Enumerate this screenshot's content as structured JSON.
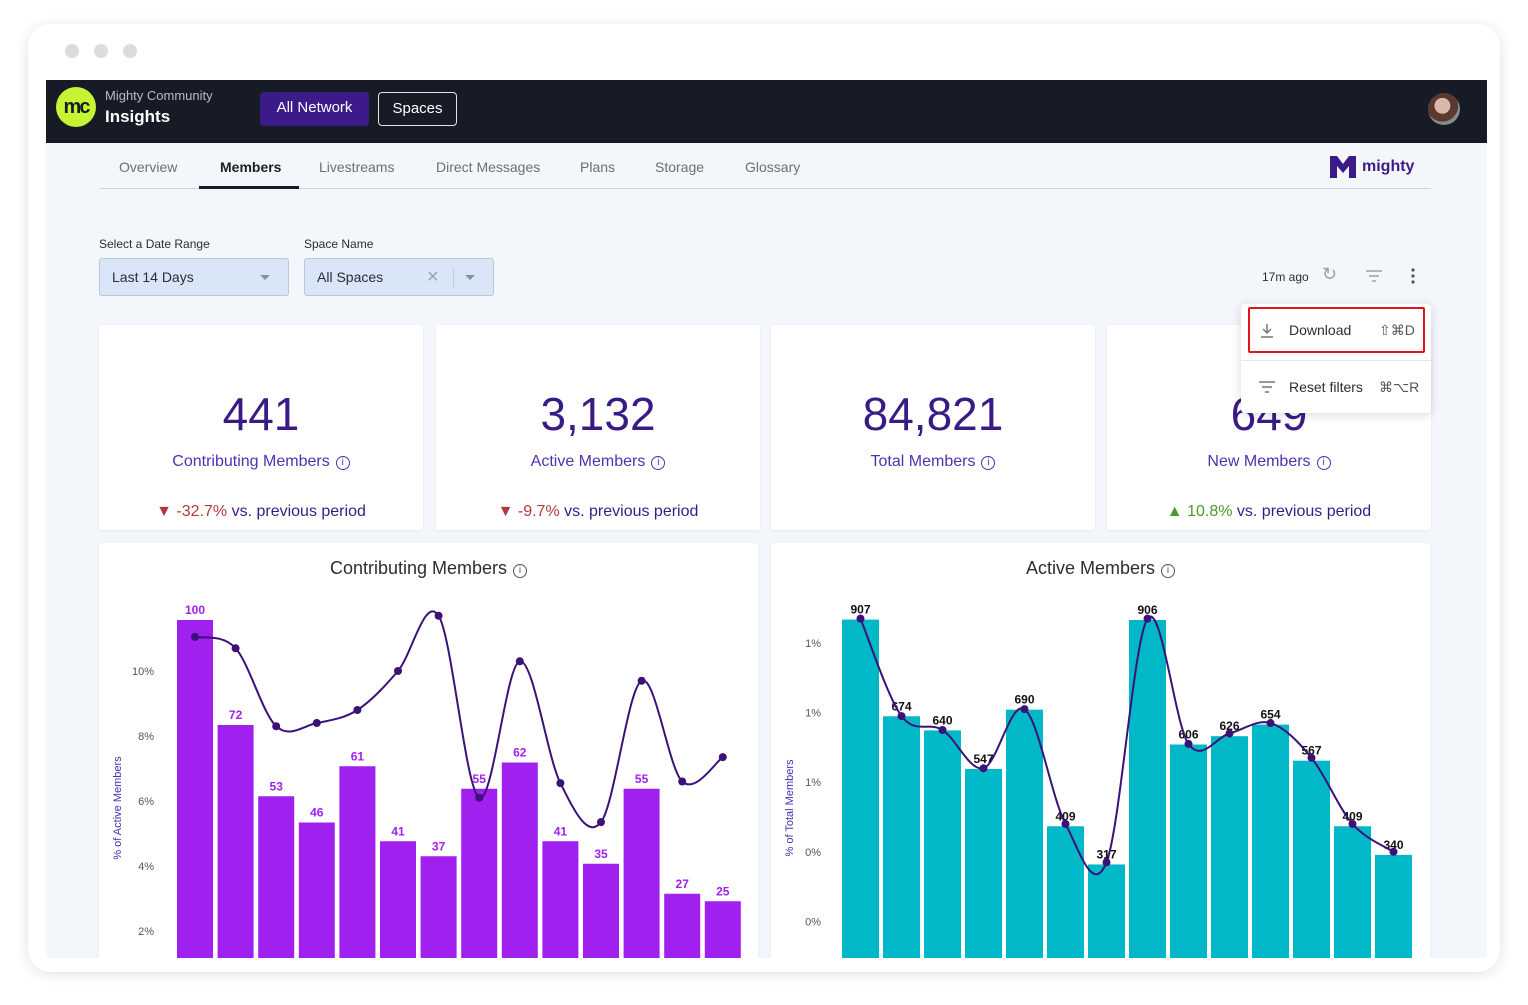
{
  "header": {
    "org": "Mighty Community",
    "title": "Insights",
    "logo_text": "mc",
    "buttons": [
      "All Network",
      "Spaces"
    ],
    "accent": "#3d1a8a"
  },
  "tabs": [
    "Overview",
    "Members",
    "Livestreams",
    "Direct Messages",
    "Plans",
    "Storage",
    "Glossary"
  ],
  "active_tab": "Members",
  "brand": "mighty",
  "filters": {
    "date_label": "Select a Date Range",
    "date_value": "Last 14 Days",
    "space_label": "Space Name",
    "space_value": "All Spaces"
  },
  "toolbar": {
    "updated": "17m ago"
  },
  "menu": {
    "items": [
      {
        "label": "Download",
        "shortcut": "⇧⌘D",
        "icon": "download-icon"
      },
      {
        "label": "Reset filters",
        "shortcut": "⌘⌥R",
        "icon": "filter-icon"
      }
    ]
  },
  "kpis": [
    {
      "value": "441",
      "label": "Contributing Members",
      "change": "-32.7%",
      "suffix": " vs. previous period",
      "dir": "down"
    },
    {
      "value": "3,132",
      "label": "Active Members",
      "change": "-9.7%",
      "suffix": " vs. previous period",
      "dir": "down"
    },
    {
      "value": "84,821",
      "label": "Total Members",
      "change": "",
      "suffix": "",
      "dir": ""
    },
    {
      "value": "649",
      "label": "New Members",
      "change": "10.8%",
      "suffix": " vs. previous period",
      "dir": "up"
    }
  ],
  "colors": {
    "down": "#b23a3a",
    "up": "#4a9a2a",
    "bar1": "#a020f0",
    "bar2": "#00b8c8",
    "line": "#3a1278"
  },
  "chart_data": [
    {
      "type": "bar",
      "title": "Contributing Members",
      "ylabel": "% of Active Members",
      "yticks": [
        10,
        8,
        6,
        4,
        2
      ],
      "ytick_labels": [
        "10%",
        "8%",
        "6%",
        "4%",
        "2%"
      ],
      "series": [
        {
          "type": "bar",
          "values": [
            100,
            72,
            53,
            46,
            61,
            41,
            37,
            55,
            62,
            41,
            35,
            55,
            27,
            25
          ]
        },
        {
          "type": "line",
          "values": [
            11.05,
            10.7,
            8.3,
            8.4,
            8.8,
            10.0,
            11.7,
            6.1,
            10.3,
            6.55,
            5.35,
            9.7,
            6.6,
            7.35
          ]
        }
      ]
    },
    {
      "type": "bar",
      "title": "Active Members",
      "ylabel": "% of Total Members",
      "yticks": [
        1.0,
        0.8,
        0.6,
        0.4,
        0.2
      ],
      "ytick_labels": [
        "1%",
        "1%",
        "1%",
        "0%",
        "0%"
      ],
      "series": [
        {
          "type": "bar",
          "values": [
            907,
            674,
            640,
            547,
            690,
            409,
            317,
            906,
            606,
            626,
            654,
            567,
            409,
            340
          ]
        },
        {
          "type": "line",
          "values": [
            1.07,
            0.79,
            0.75,
            0.64,
            0.81,
            0.48,
            0.37,
            1.07,
            0.71,
            0.74,
            0.77,
            0.67,
            0.48,
            0.4
          ]
        }
      ]
    }
  ]
}
